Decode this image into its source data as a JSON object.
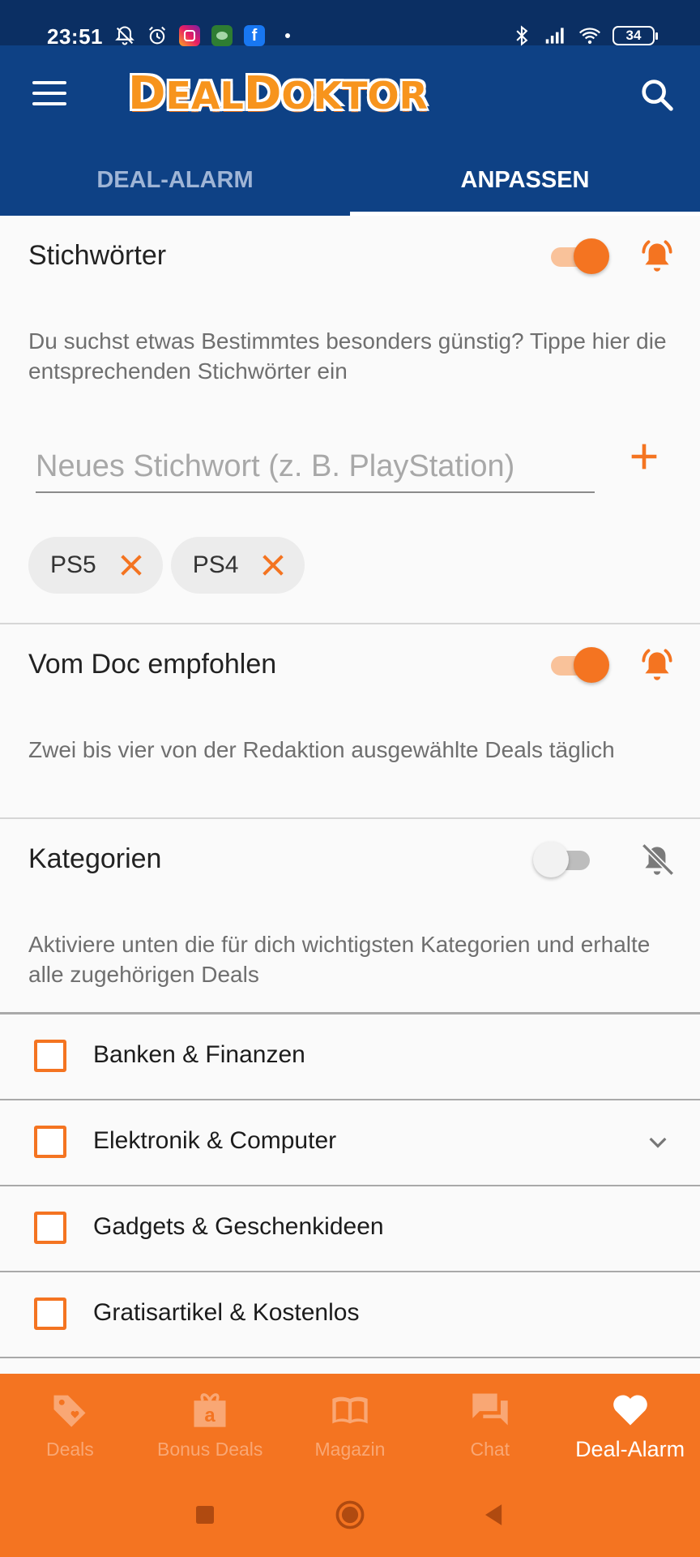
{
  "status_bar": {
    "time": "23:51",
    "battery": "34"
  },
  "colors": {
    "header_blue": "#0e4185",
    "status_blue": "#0b2f63",
    "accent_orange": "#f47421"
  },
  "app": {
    "logo": "DealDoktor"
  },
  "tabs": [
    {
      "label": "DEAL-ALARM",
      "active": false
    },
    {
      "label": "ANPASSEN",
      "active": true
    }
  ],
  "keywords": {
    "title": "Stichwörter",
    "toggle_on": true,
    "description": "Du suchst etwas Bestimmtes besonders günstig? Tippe hier die entsprechenden Stichwörter ein",
    "input_placeholder": "Neues Stichwort (z. B. PlayStation)",
    "input_value": "",
    "chips": [
      "PS5",
      "PS4"
    ]
  },
  "recommended": {
    "title": "Vom Doc empfohlen",
    "toggle_on": true,
    "description": "Zwei bis vier von der Redaktion ausgewählte Deals täglich"
  },
  "categories": {
    "title": "Kategorien",
    "toggle_on": false,
    "description": "Aktiviere unten die für dich wichtigsten Kategorien und erhalte alle zugehörigen Deals",
    "items": [
      {
        "label": "Banken & Finanzen",
        "checked": false,
        "expandable": false
      },
      {
        "label": "Elektronik & Computer",
        "checked": false,
        "expandable": true
      },
      {
        "label": "Gadgets & Geschenkideen",
        "checked": false,
        "expandable": false
      },
      {
        "label": "Gratisartikel & Kostenlos",
        "checked": false,
        "expandable": false
      }
    ]
  },
  "bottom_nav": [
    {
      "label": "Deals",
      "icon": "tag-icon",
      "active": false
    },
    {
      "label": "Bonus Deals",
      "icon": "gift-icon",
      "active": false
    },
    {
      "label": "Magazin",
      "icon": "book-icon",
      "active": false
    },
    {
      "label": "Chat",
      "icon": "chat-icon",
      "active": false
    },
    {
      "label": "Deal-Alarm",
      "icon": "heart-icon",
      "active": true
    }
  ]
}
